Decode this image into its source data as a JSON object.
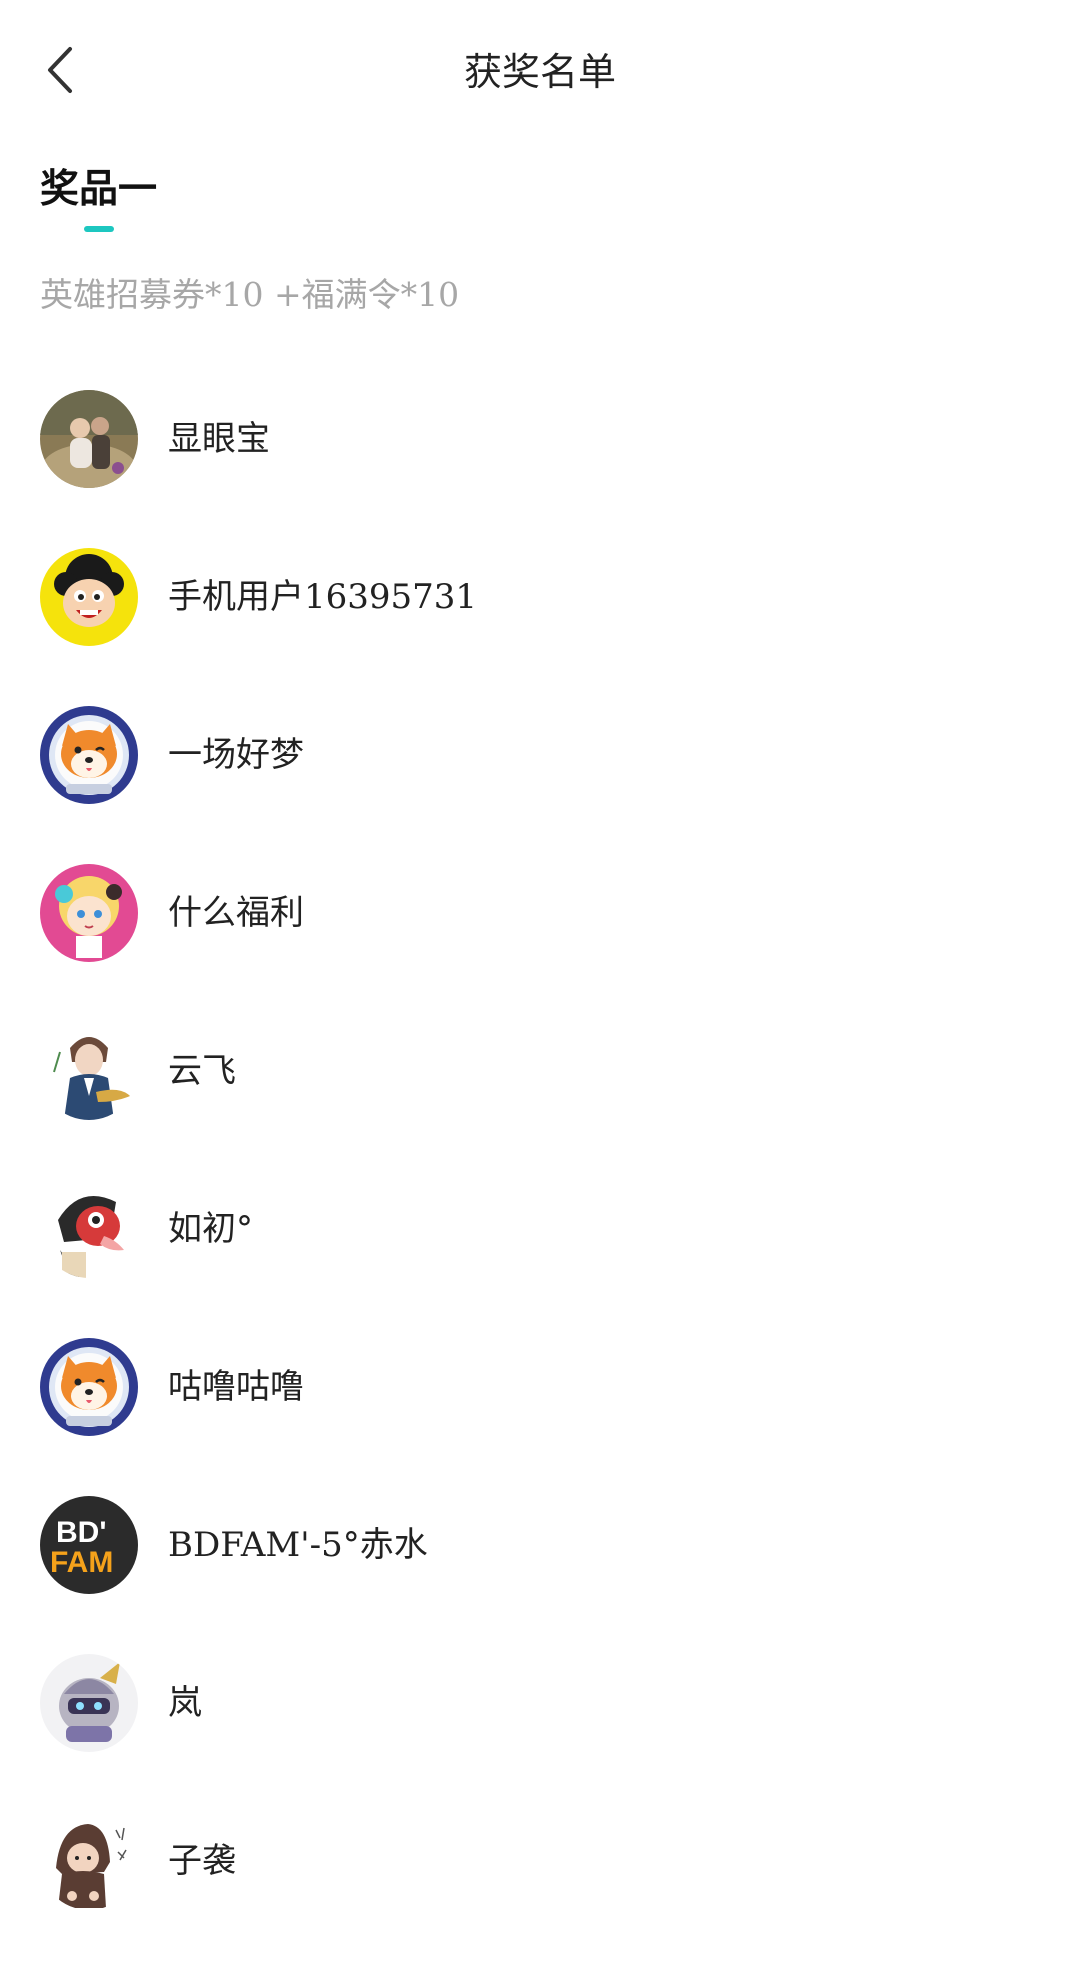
{
  "header": {
    "title": "获奖名单",
    "back_icon": "chevron-left-icon"
  },
  "tab": {
    "label": "奖品一",
    "indicator_color": "#1dc7c0"
  },
  "prize": {
    "description": "英雄招募券*10 +福满令*10"
  },
  "winners": [
    {
      "name": "显眼宝",
      "avatar": "photo-avatar"
    },
    {
      "name": "手机用户16395731",
      "avatar": "cartoon-girl-yellow-avatar"
    },
    {
      "name": "一场好梦",
      "avatar": "shiba-astronaut-avatar"
    },
    {
      "name": "什么福利",
      "avatar": "anime-girl-pink-avatar"
    },
    {
      "name": "云飞",
      "avatar": "anime-character-avatar"
    },
    {
      "name": "如初°",
      "avatar": "red-mask-character-avatar"
    },
    {
      "name": "咕噜咕噜",
      "avatar": "shiba-astronaut-avatar"
    },
    {
      "name": "BDFAM'-5°赤水",
      "avatar": "bd-fam-logo-avatar",
      "avatar_text_1": "BD'",
      "avatar_text_2": "FAM"
    },
    {
      "name": "岚",
      "avatar": "knight-robot-avatar"
    },
    {
      "name": "子袭",
      "avatar": "hooded-doll-avatar"
    }
  ]
}
